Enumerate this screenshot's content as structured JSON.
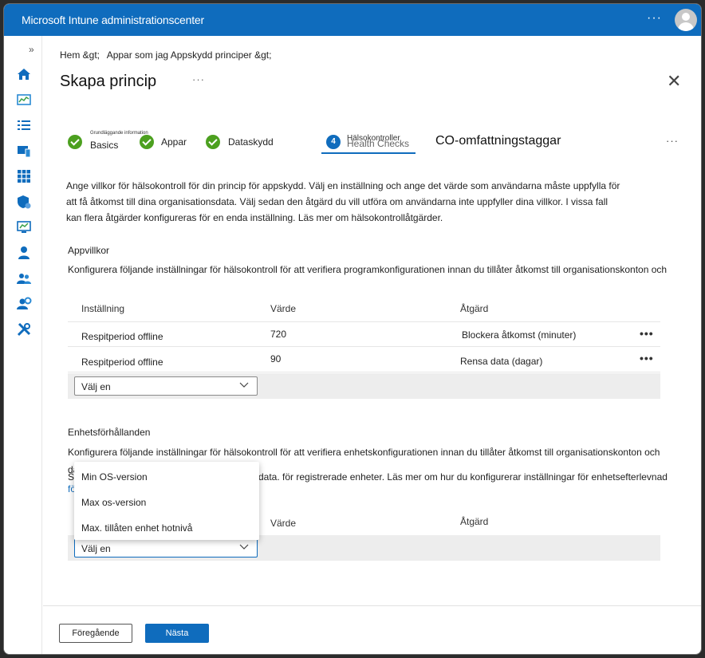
{
  "app": {
    "title": "Microsoft Intune administrationscenter",
    "more": "···"
  },
  "nav": {
    "expand": "»"
  },
  "breadcrumb": [
    "Hem &gt;",
    "Appar som jag Appskydd principer &gt;"
  ],
  "page": {
    "title": "Skapa princip",
    "title_more": "···",
    "close": "✕"
  },
  "steps": {
    "items": [
      {
        "label": "Basics",
        "small": "Grundläggande information",
        "status": "done"
      },
      {
        "label": "Appar",
        "status": "done"
      },
      {
        "label": "Dataskydd",
        "status": "done"
      },
      {
        "label": "Health Checks",
        "small": "Hälsokontroller",
        "number": "4",
        "status": "active"
      }
    ],
    "next_step": "CO-omfattningstaggar",
    "more": "···"
  },
  "description": "Ange villkor för hälsokontroll för din princip för appskydd. Välj en inställning och ange det värde som användarna måste uppfylla för att få åtkomst till dina organisationsdata. Välj sedan den åtgärd du vill utföra om användarna inte uppfyller dina villkor. I vissa fall kan flera åtgärder konfigureras för en enda inställning. Läs mer om hälsokontrollåtgärder.",
  "app_conditions": {
    "title": "Appvillkor",
    "description": "Konfigurera följande inställningar för hälsokontroll för att verifiera programkonfigurationen innan du tillåter åtkomst till organisationskonton och",
    "headers": {
      "setting": "Inställning",
      "value": "Värde",
      "action": "Åtgärd"
    },
    "rows": [
      {
        "setting": "Respitperiod offline",
        "value": "720",
        "action": "Blockera åtkomst (minuter)"
      },
      {
        "setting": "Respitperiod offline",
        "value": "90",
        "action": "Rensa data (dagar)"
      }
    ],
    "row_more": "•••",
    "select_value": "Välj en"
  },
  "device_conditions": {
    "title": "Enhetsförhållanden",
    "description": "Konfigurera följande inställningar för hälsokontroll för att verifiera enhetskonfigurationen innan du tillåter åtkomst till organisationskonton och data.",
    "partial_text_left": "S",
    "partial_text": "data. för registrerade enheter. Läs mer om hur du konfigurerar inställningar för enhetsefterlevnad",
    "partial_link": "fö",
    "headers": {
      "value": "Värde",
      "action": "Åtgärd"
    },
    "select_value": "Välj en",
    "dropdown_options": [
      "Min OS-version",
      "Max os-version",
      "Max. tillåten enhet hotnivå"
    ]
  },
  "footer": {
    "previous": "Föregående",
    "next": "Nästa"
  },
  "colors": {
    "accent": "#0f6cbd",
    "success": "#4ca01f"
  }
}
